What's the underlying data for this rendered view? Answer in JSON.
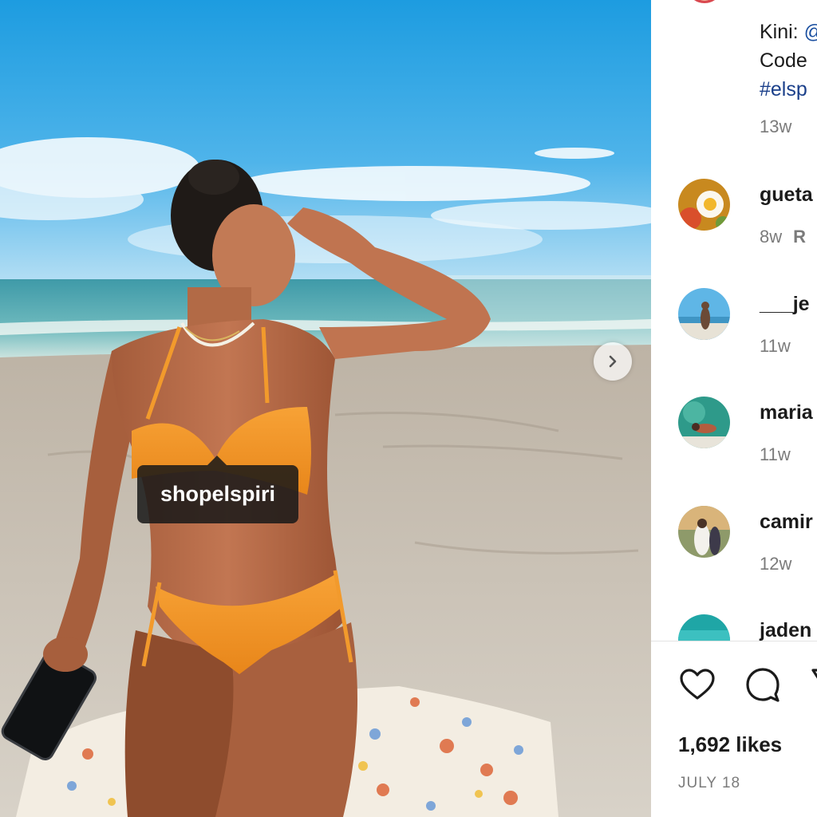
{
  "photo": {
    "tag_label": "shopelspiri"
  },
  "caption": {
    "line1_prefix": "Kini: ",
    "line1_link": "@",
    "line2": "Code",
    "hashtag": "#elsp",
    "time": "13w"
  },
  "comments": [
    {
      "username": "gueta",
      "time": "8w",
      "reply": "R"
    },
    {
      "username": "___je",
      "time": "11w",
      "reply": ""
    },
    {
      "username": "maria",
      "time": "11w",
      "reply": ""
    },
    {
      "username": "camir",
      "time": "12w",
      "reply": ""
    },
    {
      "username": "jaden",
      "time": "",
      "reply": ""
    }
  ],
  "post": {
    "likes": "1,692 likes",
    "date": "JULY 18"
  },
  "colors": {
    "link": "#1a4fa0",
    "text": "#1b1b1b",
    "muted": "#7b7b7b"
  },
  "icons": [
    "chevron-right-icon",
    "heart-icon",
    "comment-icon",
    "share-icon"
  ]
}
